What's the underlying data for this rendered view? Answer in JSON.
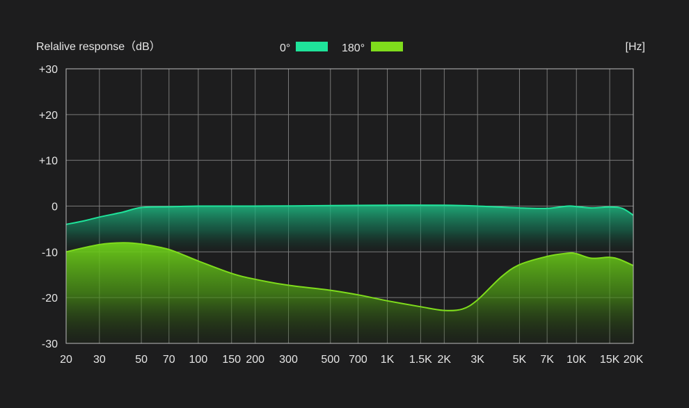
{
  "chart_data": {
    "type": "area",
    "ylabel": "Relalive response（dB）",
    "xunit": "[Hz]",
    "xscale": "log",
    "xlim": [
      20,
      20000
    ],
    "ylim": [
      -30,
      30
    ],
    "grid": true,
    "legend_position": "top-center",
    "x_ticks": [
      {
        "value": 20,
        "label": "20"
      },
      {
        "value": 30,
        "label": "30"
      },
      {
        "value": 50,
        "label": "50"
      },
      {
        "value": 70,
        "label": "70"
      },
      {
        "value": 100,
        "label": "100"
      },
      {
        "value": 150,
        "label": "150"
      },
      {
        "value": 200,
        "label": "200"
      },
      {
        "value": 300,
        "label": "300"
      },
      {
        "value": 500,
        "label": "500"
      },
      {
        "value": 700,
        "label": "700"
      },
      {
        "value": 1000,
        "label": "1K"
      },
      {
        "value": 1500,
        "label": "1.5K"
      },
      {
        "value": 2000,
        "label": "2K"
      },
      {
        "value": 3000,
        "label": "3K"
      },
      {
        "value": 5000,
        "label": "5K"
      },
      {
        "value": 7000,
        "label": "7K"
      },
      {
        "value": 10000,
        "label": "10K"
      },
      {
        "value": 15000,
        "label": "15K"
      },
      {
        "value": 20000,
        "label": "20K"
      }
    ],
    "y_ticks": [
      {
        "value": 30,
        "label": "+30"
      },
      {
        "value": 20,
        "label": "+20"
      },
      {
        "value": 10,
        "label": "+10"
      },
      {
        "value": 0,
        "label": "0"
      },
      {
        "value": -10,
        "label": "-10"
      },
      {
        "value": -20,
        "label": "-20"
      },
      {
        "value": -30,
        "label": "-30"
      }
    ],
    "series": [
      {
        "name": "0°",
        "color": "#1fe39a",
        "points": [
          [
            20,
            -4.0
          ],
          [
            25,
            -3.2
          ],
          [
            30,
            -2.4
          ],
          [
            40,
            -1.3
          ],
          [
            50,
            -0.3
          ],
          [
            70,
            -0.15
          ],
          [
            100,
            0
          ],
          [
            200,
            0
          ],
          [
            500,
            0.1
          ],
          [
            1000,
            0.2
          ],
          [
            2000,
            0.2
          ],
          [
            3000,
            0.0
          ],
          [
            5000,
            -0.4
          ],
          [
            7000,
            -0.5
          ],
          [
            9000,
            0.0
          ],
          [
            10000,
            -0.1
          ],
          [
            12000,
            -0.4
          ],
          [
            15000,
            -0.2
          ],
          [
            17500,
            -0.5
          ],
          [
            20000,
            -2.0
          ]
        ]
      },
      {
        "name": "180°",
        "color": "#7fdc1c",
        "points": [
          [
            20,
            -10.0
          ],
          [
            30,
            -8.4
          ],
          [
            40,
            -8.0
          ],
          [
            50,
            -8.3
          ],
          [
            70,
            -9.5
          ],
          [
            100,
            -12.0
          ],
          [
            150,
            -14.7
          ],
          [
            200,
            -16.0
          ],
          [
            300,
            -17.3
          ],
          [
            500,
            -18.4
          ],
          [
            700,
            -19.4
          ],
          [
            1000,
            -20.7
          ],
          [
            1500,
            -22.0
          ],
          [
            2000,
            -22.8
          ],
          [
            2500,
            -22.5
          ],
          [
            3000,
            -20.5
          ],
          [
            4000,
            -15.5
          ],
          [
            5000,
            -12.8
          ],
          [
            7000,
            -11.0
          ],
          [
            9000,
            -10.3
          ],
          [
            10000,
            -10.4
          ],
          [
            12000,
            -11.4
          ],
          [
            15000,
            -11.2
          ],
          [
            17000,
            -11.7
          ],
          [
            20000,
            -13.0
          ]
        ]
      }
    ]
  }
}
